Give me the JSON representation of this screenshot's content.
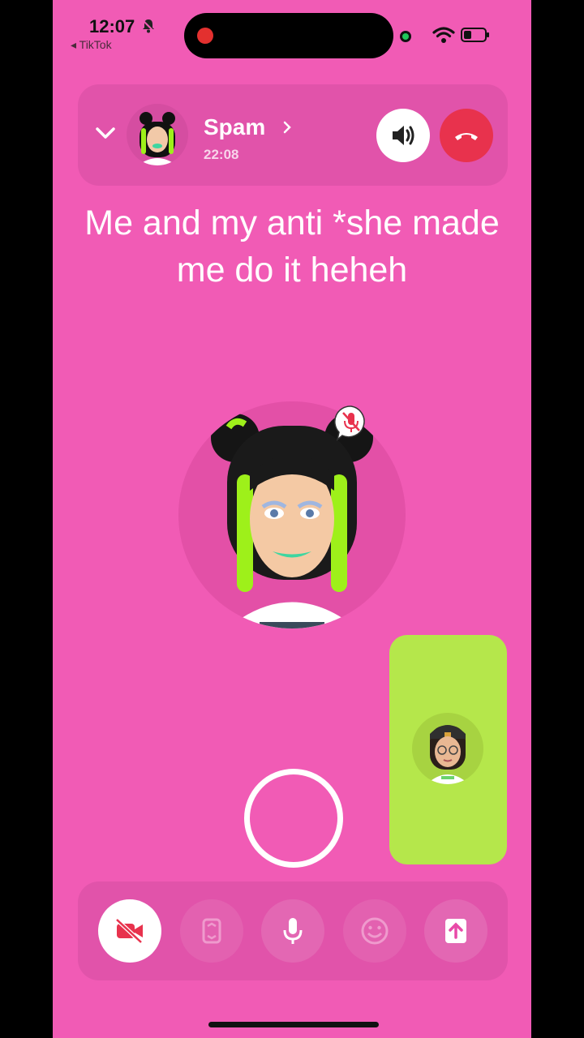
{
  "status_bar": {
    "time": "12:07",
    "back_app": "◂ TikTok",
    "recording_color": "#e3302f",
    "camera_indicator_color": "#1fc75a"
  },
  "call": {
    "caller_name": "Spam",
    "duration": "22:08",
    "hangup_color": "#e8324d"
  },
  "caption": {
    "line1": "Me and my anti *she made",
    "line2": "me do it heheh"
  },
  "colors": {
    "background": "#f15bb5",
    "self_view": "#b5e74b"
  },
  "toolbar": {
    "items": [
      {
        "icon": "video-off-icon",
        "state": "active"
      },
      {
        "icon": "flip-camera-icon",
        "state": "disabled"
      },
      {
        "icon": "microphone-icon",
        "state": "enabled"
      },
      {
        "icon": "emoji-icon",
        "state": "disabled"
      },
      {
        "icon": "share-icon",
        "state": "enabled"
      }
    ]
  }
}
